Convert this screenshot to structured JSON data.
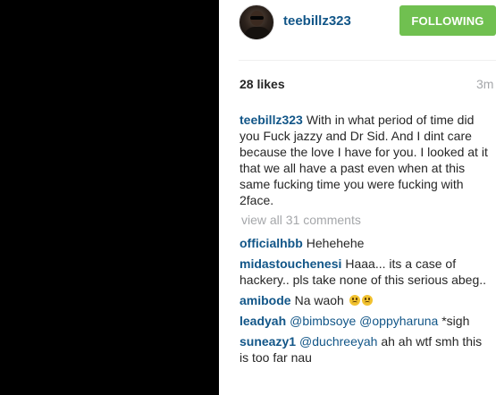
{
  "post": {
    "username": "teebillz323",
    "follow_label": "FOLLOWING",
    "likes": "28 likes",
    "time_ago": "3m"
  },
  "caption": {
    "author": "teebillz323",
    "text": "With in what period of time did you Fuck jazzy and Dr Sid. And I dint care because the love I have for you. I looked at it that we all have a past even when at this same fucking time you were fucking with 2face."
  },
  "view_all": "view all 31 comments",
  "comments": [
    {
      "author": "officialhbb",
      "text": "Hehehehe"
    },
    {
      "author": "midastouchenesi",
      "text": "Haaa... its a case of hackery.. pls take none of this serious abeg.."
    },
    {
      "author": "amibode",
      "text": "Na waoh",
      "emoji": "worried-face-icon"
    },
    {
      "author": "leadyah",
      "mention1": "@bimbsoye",
      "mention2": "@oppyharuna",
      "text": "*sigh"
    },
    {
      "author": "suneazy1",
      "mention1": "@duchreeyah",
      "text": "ah ah wtf smh this is too far nau"
    }
  ]
}
